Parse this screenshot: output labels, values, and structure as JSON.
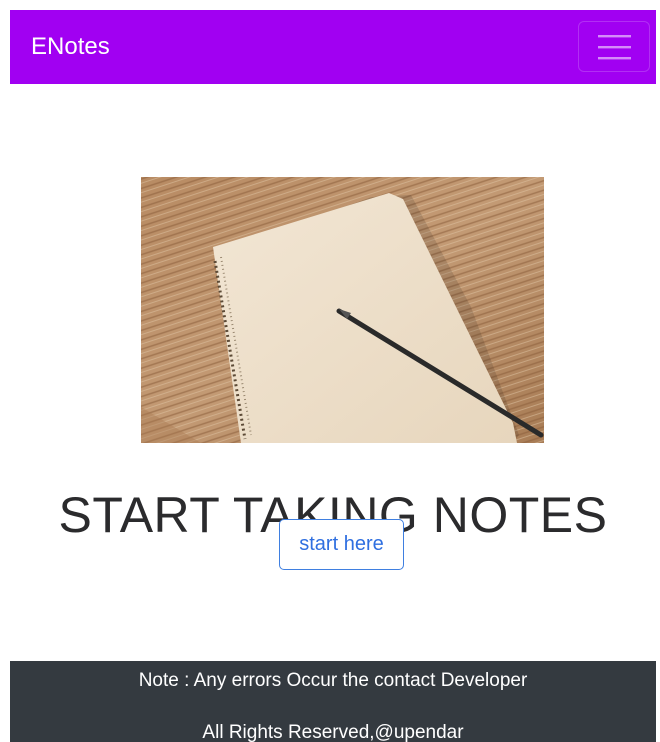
{
  "navbar": {
    "brand": "ENotes",
    "toggler_icon": "hamburger-menu-icon",
    "background_color": "#a100f2"
  },
  "hero": {
    "image_subject": "spiral notebook with pencil on wooden desk",
    "headline": "START TAKING NOTES",
    "button_label": "start here",
    "button_color": "#2f6fe0"
  },
  "footer": {
    "note": "Note : Any errors Occur the contact Developer",
    "rights": "All Rights Reserved,@upendar",
    "background_color": "#343a40"
  }
}
